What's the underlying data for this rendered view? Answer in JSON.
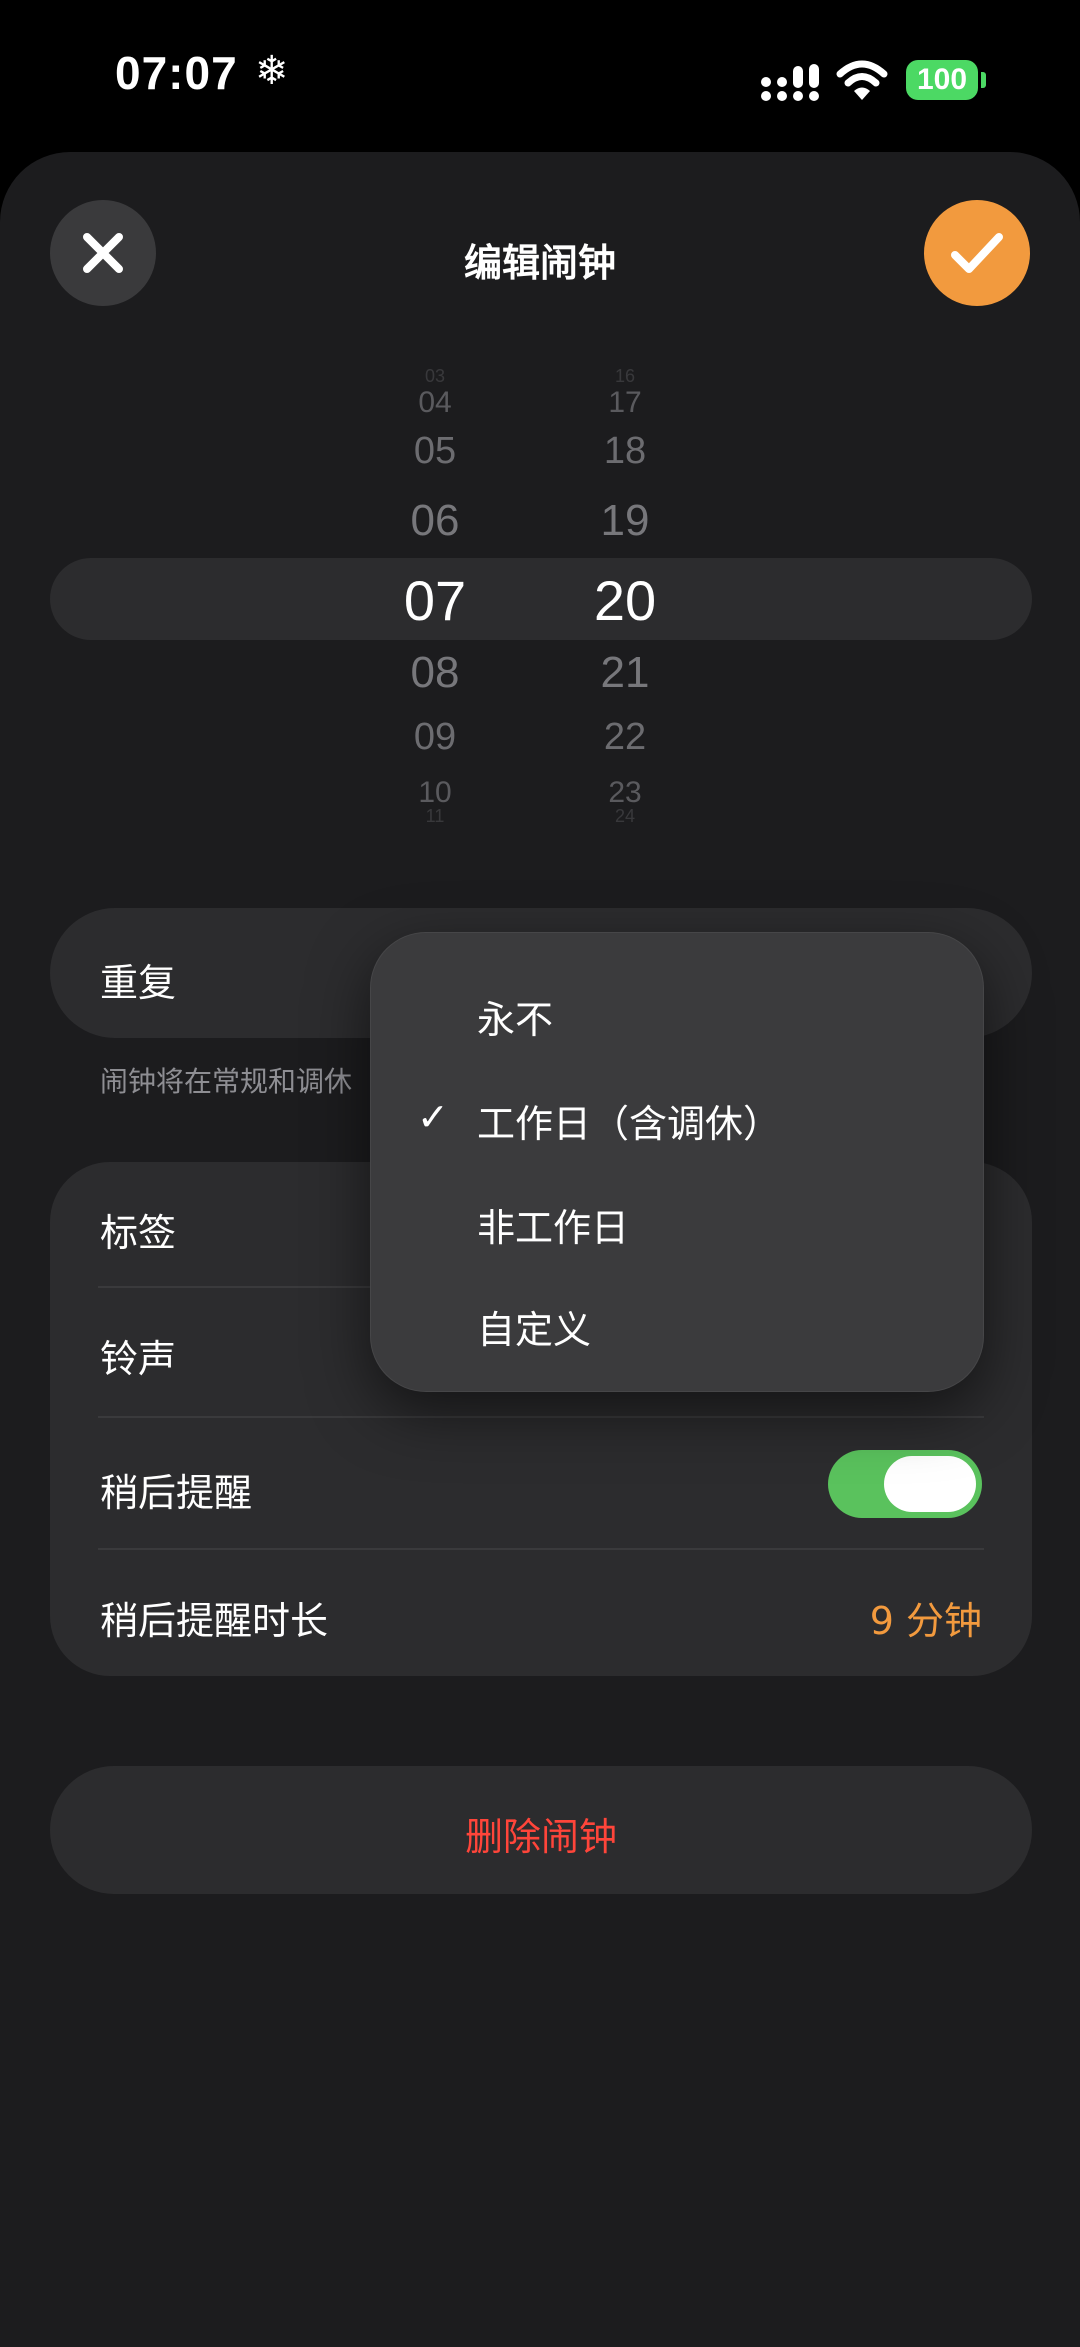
{
  "status_bar": {
    "time": "07:07",
    "weather_glyph": "❄",
    "battery": "100",
    "icons": [
      "signal-icon",
      "wifi-icon",
      "battery-icon"
    ]
  },
  "header": {
    "title": "编辑闹钟",
    "close_icon": "close-icon",
    "confirm_icon": "checkmark-icon"
  },
  "picker": {
    "hours": [
      "03",
      "04",
      "05",
      "06",
      "07",
      "08",
      "09",
      "10",
      "11"
    ],
    "minutes": [
      "16",
      "17",
      "18",
      "19",
      "20",
      "21",
      "22",
      "23",
      "24"
    ],
    "selected_hour": "07",
    "selected_minute": "20"
  },
  "repeat": {
    "label": "重复",
    "footnote": "闹钟将在常规和调休"
  },
  "settings": {
    "label_row": "标签",
    "ringtone_row": "铃声",
    "snooze_row": "稍后提醒",
    "snooze_enabled": true,
    "snooze_duration_row": "稍后提醒时长",
    "snooze_duration_value": "9 分钟"
  },
  "delete": {
    "label": "删除闹钟"
  },
  "repeat_menu": {
    "options": [
      {
        "label": "永不",
        "checked": false
      },
      {
        "label": "工作日（含调休）",
        "checked": true
      },
      {
        "label": "非工作日",
        "checked": false
      },
      {
        "label": "自定义",
        "checked": false
      }
    ],
    "check_glyph": "✓"
  },
  "colors": {
    "accent": "#f29a3e",
    "toggle_on": "#5ac25d",
    "destructive": "#ff453a",
    "battery": "#4cd964"
  }
}
